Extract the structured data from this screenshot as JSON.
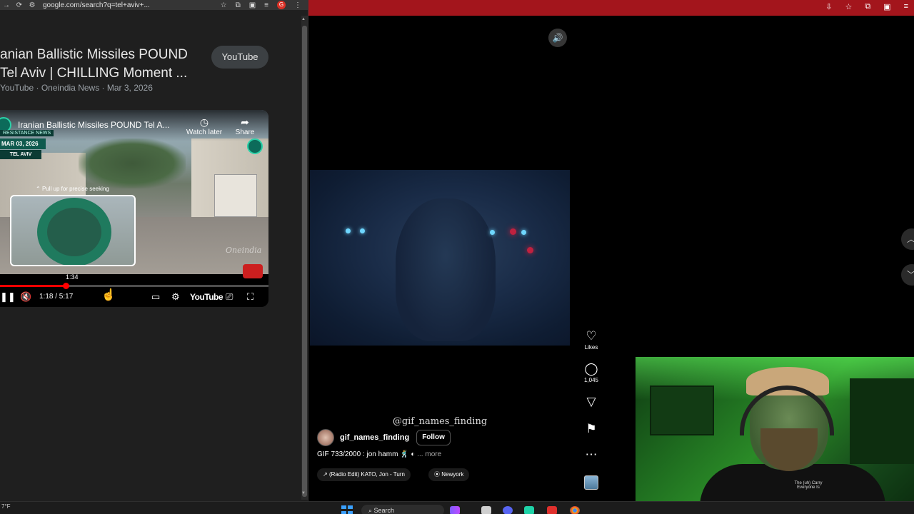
{
  "left_browser": {
    "url": "google.com/search?q=tel+aviv+...",
    "profile_letter": "G",
    "result": {
      "title": "anian Ballistic Missiles POUND Tel Aviv | CHILLING Moment ...",
      "source_chip": "YouTube",
      "meta": "YouTube · Oneindia News · Mar 3, 2026"
    },
    "player": {
      "title": "Iranian Ballistic Missiles POUND Tel A...",
      "watch_later": "Watch later",
      "share": "Share",
      "tag_resistance": "RESISTANCE NEWS",
      "tag_date": "MAR 03, 2026",
      "tag_location": "TEL AVIV",
      "watermark": "Oneindia",
      "seek_hint": "Pull up for precise seeking",
      "preview_time": "1:34",
      "time": "1:18 / 5:17",
      "youtube_label": "YouTube",
      "progress_fraction": 0.246
    }
  },
  "right_browser": {
    "reel": {
      "watermark": "@gif_names_finding",
      "author": "gif_names_finding",
      "follow_label": "Follow",
      "caption": "GIF 733/2000 : jon hamm",
      "more_label": "... more",
      "audio": "(Radio Edit) KATO, Jon - Turn",
      "location": "Newyork"
    },
    "actions": {
      "likes_label": "Likes",
      "comments_count": "1,045"
    }
  },
  "webcam": {
    "shirt_text": "The (uh) Carry Everyone Is"
  },
  "taskbar": {
    "temperature": "7°F",
    "search_placeholder": "Search"
  }
}
